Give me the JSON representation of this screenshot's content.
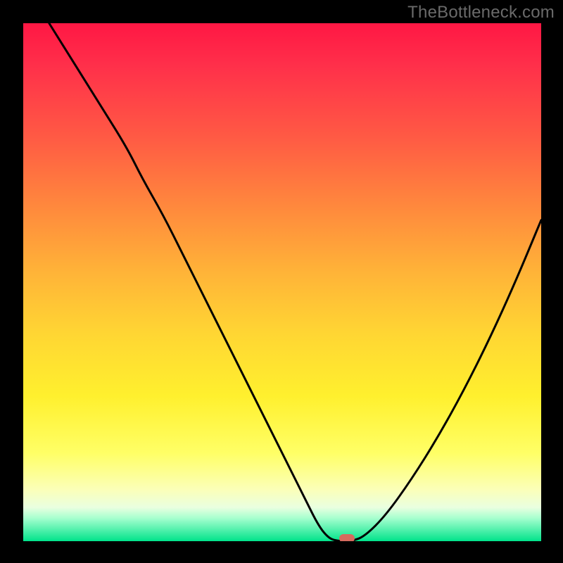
{
  "watermark": "TheBottleneck.com",
  "chart_data": {
    "type": "line",
    "title": "",
    "xlabel": "",
    "ylabel": "",
    "xlim": [
      0,
      100
    ],
    "ylim": [
      0,
      100
    ],
    "grid": false,
    "background_gradient": {
      "stops": [
        {
          "offset": 0.0,
          "color": "#ff1744"
        },
        {
          "offset": 0.08,
          "color": "#ff2f4a"
        },
        {
          "offset": 0.22,
          "color": "#ff5a44"
        },
        {
          "offset": 0.35,
          "color": "#ff873d"
        },
        {
          "offset": 0.48,
          "color": "#ffb338"
        },
        {
          "offset": 0.6,
          "color": "#ffd633"
        },
        {
          "offset": 0.72,
          "color": "#fff02e"
        },
        {
          "offset": 0.83,
          "color": "#ffff66"
        },
        {
          "offset": 0.9,
          "color": "#fbffb8"
        },
        {
          "offset": 0.935,
          "color": "#e9ffe0"
        },
        {
          "offset": 0.955,
          "color": "#a8ffcf"
        },
        {
          "offset": 1.0,
          "color": "#00e38b"
        }
      ]
    },
    "series": [
      {
        "name": "bottleneck-curve",
        "color": "#000000",
        "x": [
          5,
          10,
          15,
          20,
          23,
          27,
          31,
          35,
          39,
          43,
          47,
          51,
          54.5,
          57,
          59,
          61,
          63.5,
          66,
          70,
          75,
          80,
          85,
          90,
          95,
          100
        ],
        "y": [
          100,
          92,
          84,
          76,
          70,
          63,
          55,
          47,
          39,
          31,
          23,
          15,
          8,
          3,
          0.5,
          0,
          0,
          1,
          5,
          12,
          20,
          29,
          39,
          50,
          62
        ]
      }
    ],
    "marker": {
      "x": 62.5,
      "y": 0.5,
      "color": "#d66a5e"
    }
  }
}
